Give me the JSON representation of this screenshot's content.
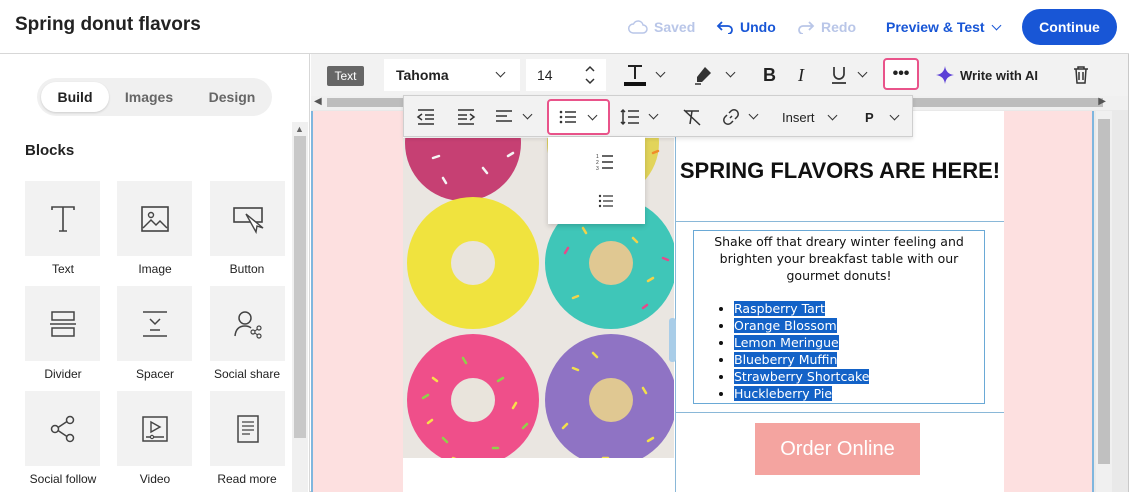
{
  "header": {
    "title": "Spring donut flavors",
    "saved": "Saved",
    "undo": "Undo",
    "redo": "Redo",
    "preview": "Preview & Test",
    "continue": "Continue"
  },
  "sidebar": {
    "tabs": [
      "Build",
      "Images",
      "Design"
    ],
    "active_tab": "Build",
    "blocks_title": "Blocks",
    "blocks": [
      {
        "label": "Text",
        "icon": "text-icon"
      },
      {
        "label": "Image",
        "icon": "image-icon"
      },
      {
        "label": "Button",
        "icon": "button-icon"
      },
      {
        "label": "Divider",
        "icon": "divider-icon"
      },
      {
        "label": "Spacer",
        "icon": "spacer-icon"
      },
      {
        "label": "Social share",
        "icon": "social-share-icon"
      },
      {
        "label": "Social follow",
        "icon": "social-follow-icon"
      },
      {
        "label": "Video",
        "icon": "video-icon"
      },
      {
        "label": "Read more",
        "icon": "read-more-icon"
      }
    ]
  },
  "toolbar": {
    "block_type": "Text",
    "font": "Tahoma",
    "size": "14",
    "write_ai": "Write with AI",
    "insert": "Insert",
    "paragraph": "P"
  },
  "email": {
    "headline": "SPRING FLAVORS ARE HERE!",
    "intro": "Shake off that dreary winter feeling and brighten your breakfast table with our gourmet donuts!",
    "flavors": [
      "Raspberry Tart",
      "Orange Blossom",
      "Lemon Meringue",
      "Blueberry Muffin",
      "Strawberry Shortcake",
      "Huckleberry Pie"
    ],
    "button": "Order Online"
  },
  "colors": {
    "accent": "#1856d6",
    "highlight": "#e9538a",
    "selection": "#1362c7",
    "canvas_bg": "#fde0e0",
    "order_button": "#f4a4a0"
  }
}
